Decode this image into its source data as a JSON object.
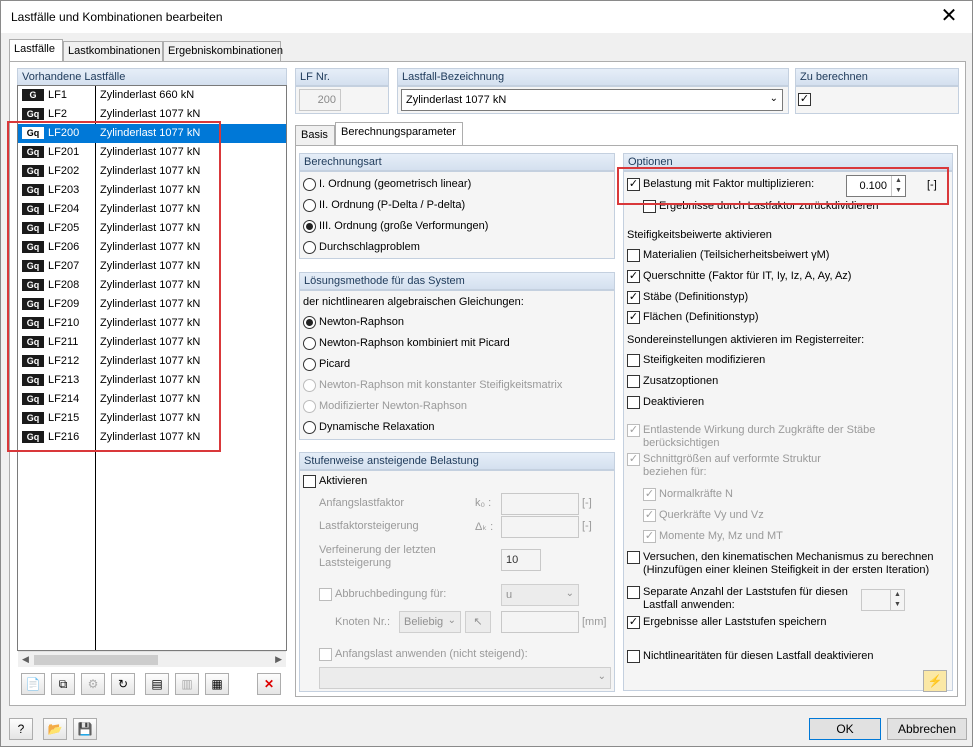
{
  "window": {
    "title": "Lastfälle und Kombinationen bearbeiten",
    "close": "✕"
  },
  "tabs": [
    "Lastfälle",
    "Lastkombinationen",
    "Ergebniskombinationen"
  ],
  "list": {
    "header": "Vorhandene Lastfälle",
    "items": [
      {
        "badge": "G",
        "id": "LF1",
        "desc": "Zylinderlast 660 kN"
      },
      {
        "badge": "Gq",
        "id": "LF2",
        "desc": "Zylinderlast 1077 kN"
      },
      {
        "badge": "Gq",
        "id": "LF200",
        "desc": "Zylinderlast 1077 kN"
      },
      {
        "badge": "Gq",
        "id": "LF201",
        "desc": "Zylinderlast 1077 kN"
      },
      {
        "badge": "Gq",
        "id": "LF202",
        "desc": "Zylinderlast 1077 kN"
      },
      {
        "badge": "Gq",
        "id": "LF203",
        "desc": "Zylinderlast 1077 kN"
      },
      {
        "badge": "Gq",
        "id": "LF204",
        "desc": "Zylinderlast 1077 kN"
      },
      {
        "badge": "Gq",
        "id": "LF205",
        "desc": "Zylinderlast 1077 kN"
      },
      {
        "badge": "Gq",
        "id": "LF206",
        "desc": "Zylinderlast 1077 kN"
      },
      {
        "badge": "Gq",
        "id": "LF207",
        "desc": "Zylinderlast 1077 kN"
      },
      {
        "badge": "Gq",
        "id": "LF208",
        "desc": "Zylinderlast 1077 kN"
      },
      {
        "badge": "Gq",
        "id": "LF209",
        "desc": "Zylinderlast 1077 kN"
      },
      {
        "badge": "Gq",
        "id": "LF210",
        "desc": "Zylinderlast 1077 kN"
      },
      {
        "badge": "Gq",
        "id": "LF211",
        "desc": "Zylinderlast 1077 kN"
      },
      {
        "badge": "Gq",
        "id": "LF212",
        "desc": "Zylinderlast 1077 kN"
      },
      {
        "badge": "Gq",
        "id": "LF213",
        "desc": "Zylinderlast 1077 kN"
      },
      {
        "badge": "Gq",
        "id": "LF214",
        "desc": "Zylinderlast 1077 kN"
      },
      {
        "badge": "Gq",
        "id": "LF215",
        "desc": "Zylinderlast 1077 kN"
      },
      {
        "badge": "Gq",
        "id": "LF216",
        "desc": "Zylinderlast 1077 kN"
      }
    ],
    "selected": "LF200"
  },
  "toolbar_icons": [
    "new-loadcase-icon",
    "copy-loadcase-icon",
    "generate-icon",
    "renumber-icon",
    "export-icon",
    "import-icon",
    "table-icon",
    "delete-icon"
  ],
  "lf_nr": {
    "label": "LF Nr.",
    "value": "200"
  },
  "bezeichnung": {
    "label": "Lastfall-Bezeichnung",
    "value": "Zylinderlast 1077 kN"
  },
  "zu_berechnen": {
    "label": "Zu berechnen",
    "checked": true
  },
  "subtabs": [
    "Basis",
    "Berechnungsparameter"
  ],
  "berechnungsart": {
    "header": "Berechnungsart",
    "options": [
      "I. Ordnung (geometrisch linear)",
      "II. Ordnung (P-Delta / P-delta)",
      "III. Ordnung (große Verformungen)",
      "Durchschlagproblem"
    ],
    "selected": 2
  },
  "loesung": {
    "header": "Lösungsmethode für das System",
    "intro": "der nichtlinearen algebraischen Gleichungen:",
    "options": [
      "Newton-Raphson",
      "Newton-Raphson kombiniert mit Picard",
      "Picard",
      "Newton-Raphson mit konstanter Steifigkeitsmatrix",
      "Modifizierter Newton-Raphson",
      "Dynamische Relaxation"
    ],
    "selected": 0
  },
  "stufen": {
    "header": "Stufenweise ansteigende Belastung",
    "aktivieren": "Aktivieren",
    "anfangs": "Anfangslastfaktor",
    "anfangs_sym": "k₀ :",
    "steig": "Lastfaktorsteigerung",
    "steig_sym": "Δₖ :",
    "unit": "[-]",
    "verf1": "Verfeinerung der letzten",
    "verf2": "Laststeigerung",
    "verf_val": "10",
    "abbruch": "Abbruchbedingung für:",
    "abbruch_val": "u",
    "knoten": "Knoten Nr.:",
    "knoten_val": "Beliebig",
    "mm": "[mm]",
    "anfangslast": "Anfangslast anwenden (nicht steigend):"
  },
  "optionen": {
    "header": "Optionen",
    "faktor_label": "Belastung mit Faktor multiplizieren:",
    "faktor_value": "0.100",
    "faktor_unit": "[-]",
    "rueck": "Ergebnisse durch Lastfaktor zurückdividieren",
    "steif_hdr": "Steifigkeitsbeiwerte aktivieren",
    "materialien": "Materialien (Teilsicherheitsbeiwert γM)",
    "querschnitte": "Querschnitte (Faktor für IT, Iy, Iz, A, Ay, Az)",
    "staebe": "Stäbe (Definitionstyp)",
    "flaechen": "Flächen (Definitionstyp)",
    "sonder_hdr": "Sondereinstellungen aktivieren im Registerreiter:",
    "steif_mod": "Steifigkeiten modifizieren",
    "zusatz": "Zusatzoptionen",
    "deakt": "Deaktivieren",
    "entl1": "Entlastende Wirkung durch Zugkräfte der Stäbe",
    "entl2": "berücksichtigen",
    "schnitt1": "Schnittgrößen auf verformte Struktur",
    "schnitt2": "beziehen für:",
    "normal": "Normalkräfte N",
    "quer": "Querkräfte Vy und Vz",
    "momente": "Momente My, Mz und MT",
    "kin1": "Versuchen, den kinematischen Mechanismus zu berechnen",
    "kin2": "(Hinzufügen einer kleinen Steifigkeit in der ersten Iteration)",
    "sep1": "Separate Anzahl der Laststufen für diesen",
    "sep2": "Lastfall anwenden:",
    "ergeb": "Ergebnisse aller Laststufen speichern",
    "nichtlin": "Nichtlinearitäten für diesen Lastfall deaktivieren"
  },
  "footer": {
    "ok": "OK",
    "cancel": "Abbrechen"
  },
  "colors": {
    "selection": "#0078d7",
    "highlight": "#d9383a"
  }
}
